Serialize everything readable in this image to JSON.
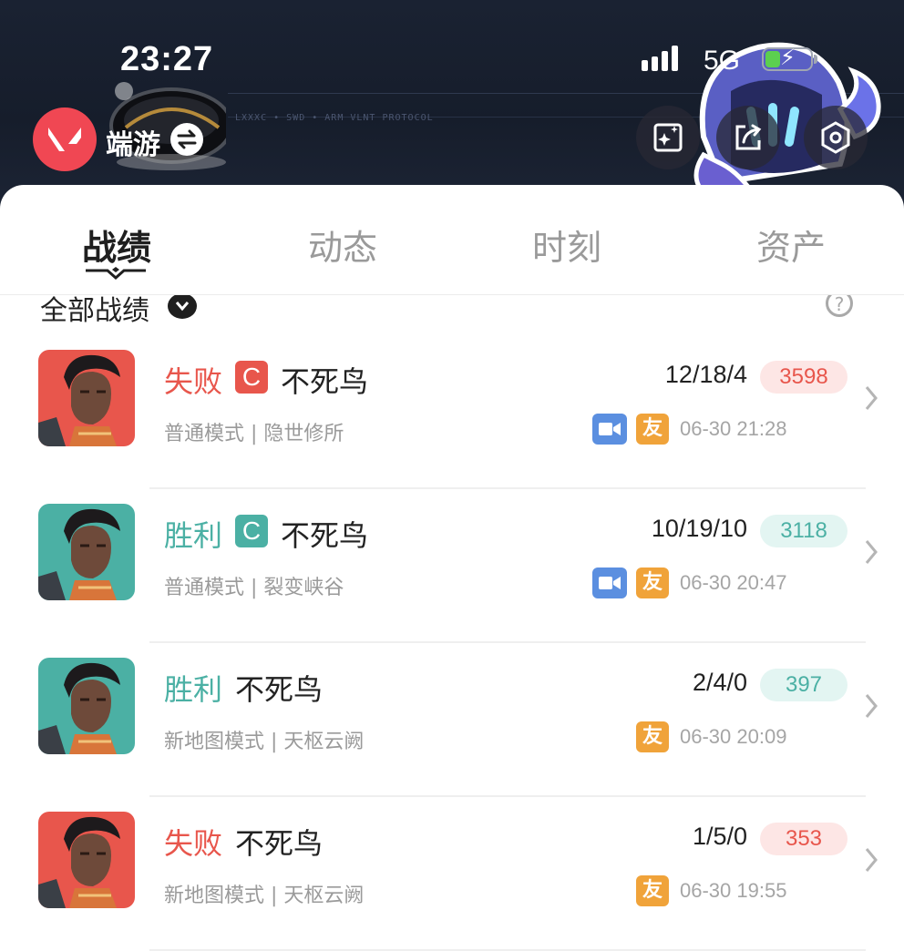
{
  "status_bar": {
    "time": "23:27",
    "network": "5G",
    "battery_level": 0.34
  },
  "header": {
    "game_name": "端游",
    "protocol_text": "LXXXC • SWD • ARM VLNT PROTOCOL",
    "icons": [
      "valorant-logo-icon",
      "switch-icon",
      "share-card-icon",
      "share-icon",
      "settings-icon"
    ]
  },
  "tabs": [
    {
      "label": "战绩",
      "active": true
    },
    {
      "label": "动态",
      "active": false
    },
    {
      "label": "时刻",
      "active": false
    },
    {
      "label": "资产",
      "active": false
    }
  ],
  "filter": {
    "label": "全部战绩"
  },
  "colors": {
    "lose": "#e8564c",
    "win": "#4bb0a4",
    "accent": "#f04753",
    "video": "#5b8fe0",
    "friend": "#f0a33a"
  },
  "matches": [
    {
      "result": "失败",
      "outcome": "lose",
      "grade": "C",
      "agent": "不死鸟",
      "kda": "12/18/4",
      "score": "3598",
      "mode": "普通模式 | 隐世修所",
      "video": true,
      "friend": "友",
      "time": "06-30 21:28"
    },
    {
      "result": "胜利",
      "outcome": "win",
      "grade": "C",
      "agent": "不死鸟",
      "kda": "10/19/10",
      "score": "3118",
      "mode": "普通模式 | 裂变峡谷",
      "video": true,
      "friend": "友",
      "time": "06-30 20:47"
    },
    {
      "result": "胜利",
      "outcome": "win",
      "grade": "",
      "agent": "不死鸟",
      "kda": "2/4/0",
      "score": "397",
      "mode": "新地图模式 | 天枢云阙",
      "video": false,
      "friend": "友",
      "time": "06-30 20:09"
    },
    {
      "result": "失败",
      "outcome": "lose",
      "grade": "",
      "agent": "不死鸟",
      "kda": "1/5/0",
      "score": "353",
      "mode": "新地图模式 | 天枢云阙",
      "video": false,
      "friend": "友",
      "time": "06-30 19:55"
    }
  ]
}
